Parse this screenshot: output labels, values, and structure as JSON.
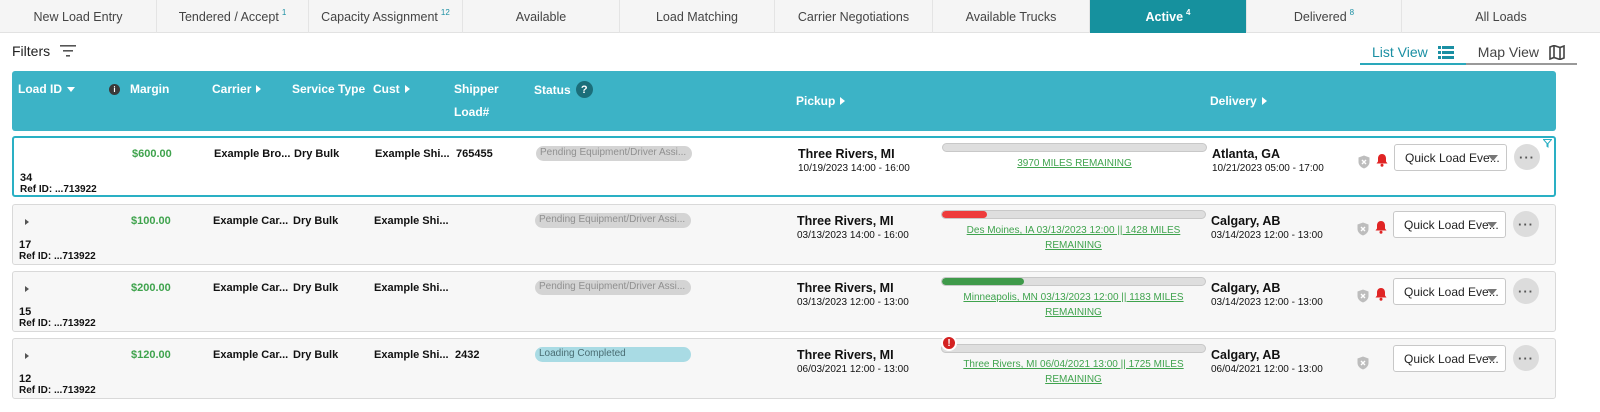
{
  "tabs": [
    {
      "label": "New Load Entry",
      "badge": ""
    },
    {
      "label": "Tendered / Accept",
      "badge": "1"
    },
    {
      "label": "Capacity Assignment",
      "badge": "12"
    },
    {
      "label": "Available",
      "badge": ""
    },
    {
      "label": "Load Matching",
      "badge": ""
    },
    {
      "label": "Carrier Negotiations",
      "badge": ""
    },
    {
      "label": "Available Trucks",
      "badge": ""
    },
    {
      "label": "Active",
      "badge": "4"
    },
    {
      "label": "Delivered",
      "badge": "8"
    },
    {
      "label": "All Loads",
      "badge": ""
    }
  ],
  "filters": {
    "label": "Filters"
  },
  "views": {
    "list": "List View",
    "map": "Map View"
  },
  "columns": {
    "load_id": "Load ID",
    "margin": "Margin",
    "carrier": "Carrier",
    "service_type": "Service Type",
    "cust": "Cust",
    "shipper_line1": "Shipper",
    "shipper_line2": "Load#",
    "status": "Status",
    "status_help": "?",
    "pickup": "Pickup",
    "delivery": "Delivery"
  },
  "rows": [
    {
      "load_id": "34",
      "ref": "Ref ID: ...713922",
      "margin": "$600.00",
      "carrier": "Example Bro...",
      "service": "Dry Bulk",
      "cust": "Example Shi...",
      "shipper": "765455",
      "status": "Pending Equipment/Driver Assi...",
      "pickup_city": "Three Rivers, MI",
      "pickup_time": "10/19/2023 14:00 - 16:00",
      "progress": 0,
      "progress_color": "#4caf50",
      "miles": "3970 MILES REMAINING",
      "delivery_city": "Atlanta, GA",
      "delivery_time": "10/21/2023 05:00 - 17:00",
      "quick": "Quick Load Eve..."
    },
    {
      "load_id": "17",
      "ref": "Ref ID: ...713922",
      "margin": "$100.00",
      "carrier": "Example Car...",
      "service": "Dry Bulk",
      "cust": "Example Shi...",
      "shipper": "",
      "status": "Pending Equipment/Driver Assi...",
      "pickup_city": "Three Rivers, MI",
      "pickup_time": "03/13/2023 14:00 - 16:00",
      "progress": 0.17,
      "progress_color": "#ee3b3b",
      "miles": "Des Moines, IA 03/13/2023 12:00 || 1428 MILES REMAINING",
      "delivery_city": "Calgary, AB",
      "delivery_time": "03/14/2023 12:00 - 13:00",
      "quick": "Quick Load Eve..."
    },
    {
      "load_id": "15",
      "ref": "Ref ID: ...713922",
      "margin": "$200.00",
      "carrier": "Example Car...",
      "service": "Dry Bulk",
      "cust": "Example Shi...",
      "shipper": "",
      "status": "Pending Equipment/Driver Assi...",
      "pickup_city": "Three Rivers, MI",
      "pickup_time": "03/13/2023 12:00 - 13:00",
      "progress": 0.31,
      "progress_color": "#3f9a4a",
      "miles": "Minneapolis, MN 03/13/2023 12:00 || 1183 MILES REMAINING",
      "delivery_city": "Calgary, AB",
      "delivery_time": "03/14/2023 12:00 - 13:00",
      "quick": "Quick Load Eve..."
    },
    {
      "load_id": "12",
      "ref": "Ref ID: ...713922",
      "margin": "$120.00",
      "carrier": "Example Car...",
      "service": "Dry Bulk",
      "cust": "Example Shi...",
      "shipper": "2432",
      "status": "Loading Completed",
      "pickup_city": "Three Rivers, MI",
      "pickup_time": "06/03/2021 12:00 - 13:00",
      "progress": 0,
      "progress_color": "#4caf50",
      "miles": "Three Rivers, MI 06/04/2021 13:00 || 1725 MILES REMAINING",
      "delivery_city": "Calgary, AB",
      "delivery_time": "06/04/2021 12:00 - 13:00",
      "quick": "Quick Load Eve...",
      "alert": "!"
    }
  ],
  "colors": {
    "accent": "#16919e",
    "header": "#3cb3c6",
    "margin_green": "#3fa34d"
  }
}
